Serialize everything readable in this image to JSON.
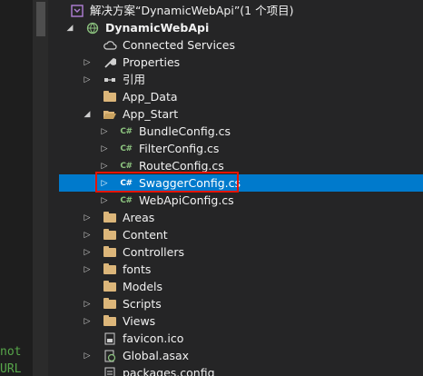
{
  "editor": {
    "snippets": [
      "not",
      "URL"
    ]
  },
  "explorer": {
    "solution": "解决方案“DynamicWebApi”(1 个项目)",
    "project": "DynamicWebApi",
    "items": [
      {
        "label": "Connected Services",
        "icon": "cloud-icon"
      },
      {
        "label": "Properties",
        "icon": "wrench-icon"
      },
      {
        "label": "引用",
        "icon": "references-icon"
      },
      {
        "label": "App_Data",
        "icon": "folder-icon"
      },
      {
        "label": "App_Start",
        "icon": "folder-open-icon"
      },
      {
        "label": "BundleConfig.cs",
        "icon": "csharp-file-icon"
      },
      {
        "label": "FilterConfig.cs",
        "icon": "csharp-file-icon"
      },
      {
        "label": "RouteConfig.cs",
        "icon": "csharp-file-icon"
      },
      {
        "label": "SwaggerConfig.cs",
        "icon": "csharp-file-icon"
      },
      {
        "label": "WebApiConfig.cs",
        "icon": "csharp-file-icon"
      },
      {
        "label": "Areas",
        "icon": "folder-icon"
      },
      {
        "label": "Content",
        "icon": "folder-icon"
      },
      {
        "label": "Controllers",
        "icon": "folder-icon"
      },
      {
        "label": "fonts",
        "icon": "folder-icon"
      },
      {
        "label": "Models",
        "icon": "folder-icon"
      },
      {
        "label": "Scripts",
        "icon": "folder-icon"
      },
      {
        "label": "Views",
        "icon": "folder-icon"
      },
      {
        "label": "favicon.ico",
        "icon": "image-file-icon"
      },
      {
        "label": "Global.asax",
        "icon": "asax-file-icon"
      },
      {
        "label": "packages.config",
        "icon": "config-file-icon"
      }
    ],
    "csharp_glyph": "C#",
    "selected_color": "#007acc",
    "highlight_color": "#e51400"
  }
}
